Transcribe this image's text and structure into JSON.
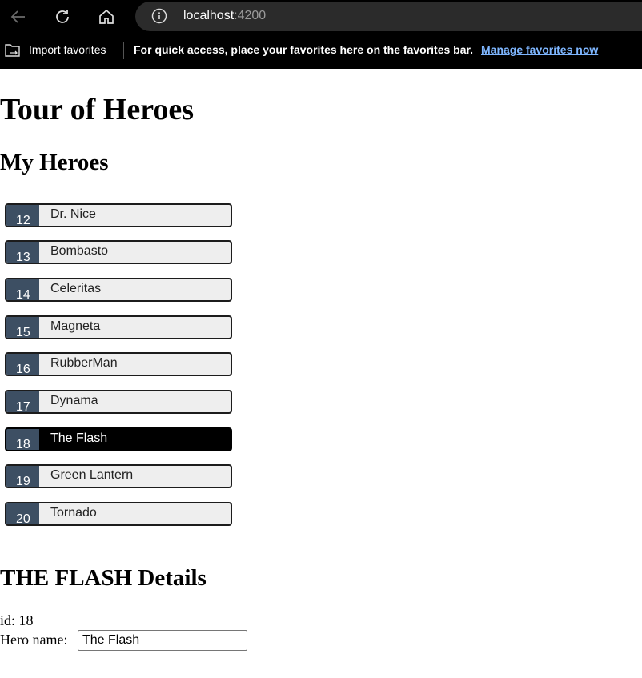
{
  "browser": {
    "address_host": "localhost",
    "address_port": ":4200",
    "favorites": {
      "import_label": "Import favorites",
      "message": "For quick access, place your favorites here on the favorites bar.",
      "manage_link": "Manage favorites now"
    }
  },
  "page": {
    "title": "Tour of Heroes",
    "list_title": "My Heroes",
    "heroes": [
      {
        "id": "12",
        "name": "Dr. Nice",
        "selected": false
      },
      {
        "id": "13",
        "name": "Bombasto",
        "selected": false
      },
      {
        "id": "14",
        "name": "Celeritas",
        "selected": false
      },
      {
        "id": "15",
        "name": "Magneta",
        "selected": false
      },
      {
        "id": "16",
        "name": "RubberMan",
        "selected": false
      },
      {
        "id": "17",
        "name": "Dynama",
        "selected": false
      },
      {
        "id": "18",
        "name": "The Flash",
        "selected": true
      },
      {
        "id": "19",
        "name": "Green Lantern",
        "selected": false
      },
      {
        "id": "20",
        "name": "Tornado",
        "selected": false
      }
    ],
    "details": {
      "title": "THE FLASH Details",
      "id_text": "id: 18",
      "name_label": "Hero name:",
      "name_value": "The Flash"
    }
  },
  "colors": {
    "badge_bg": "#3d4f63",
    "item_bg": "#eeeeee",
    "selected_bg": "#000000",
    "link": "#7eb6ff"
  }
}
